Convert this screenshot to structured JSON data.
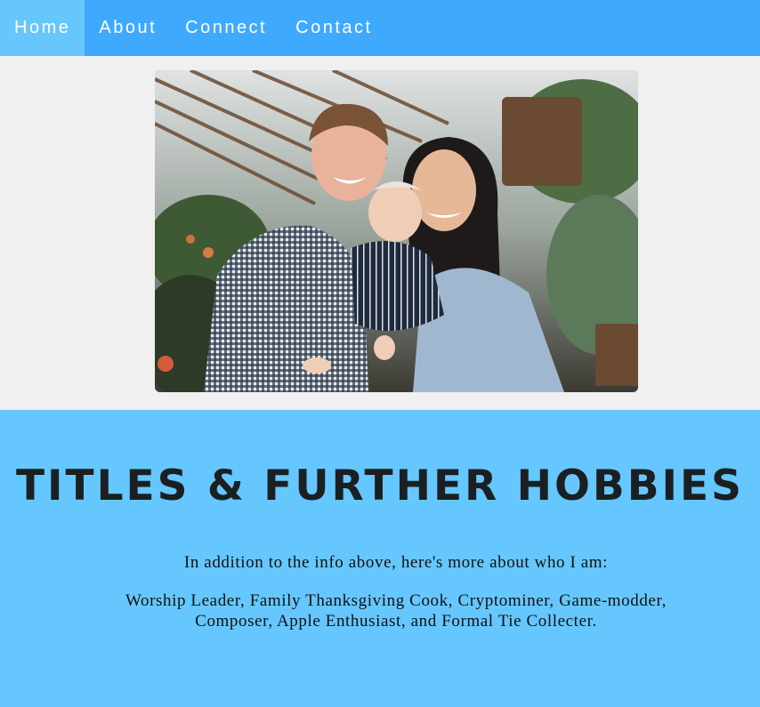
{
  "nav": {
    "items": [
      {
        "label": "Home",
        "active": true
      },
      {
        "label": "About",
        "active": false
      },
      {
        "label": "Connect",
        "active": false
      },
      {
        "label": "Contact",
        "active": false
      }
    ]
  },
  "hero": {
    "photo_icon": "family-photo"
  },
  "hobbies": {
    "title": "TITLES & FURTHER HOBBIES",
    "intro": "In addition to the info above, here's more about who I am:",
    "list": "Worship Leader, Family Thanksgiving Cook, Cryptominer, Game-modder, Composer, Apple Enthusiast, and Formal Tie Collecter."
  },
  "colors": {
    "nav_bg": "#3fa9fd",
    "nav_active_bg": "#67c6fc",
    "section_bg": "#65c7fd",
    "page_bg": "#f0f0f0"
  }
}
